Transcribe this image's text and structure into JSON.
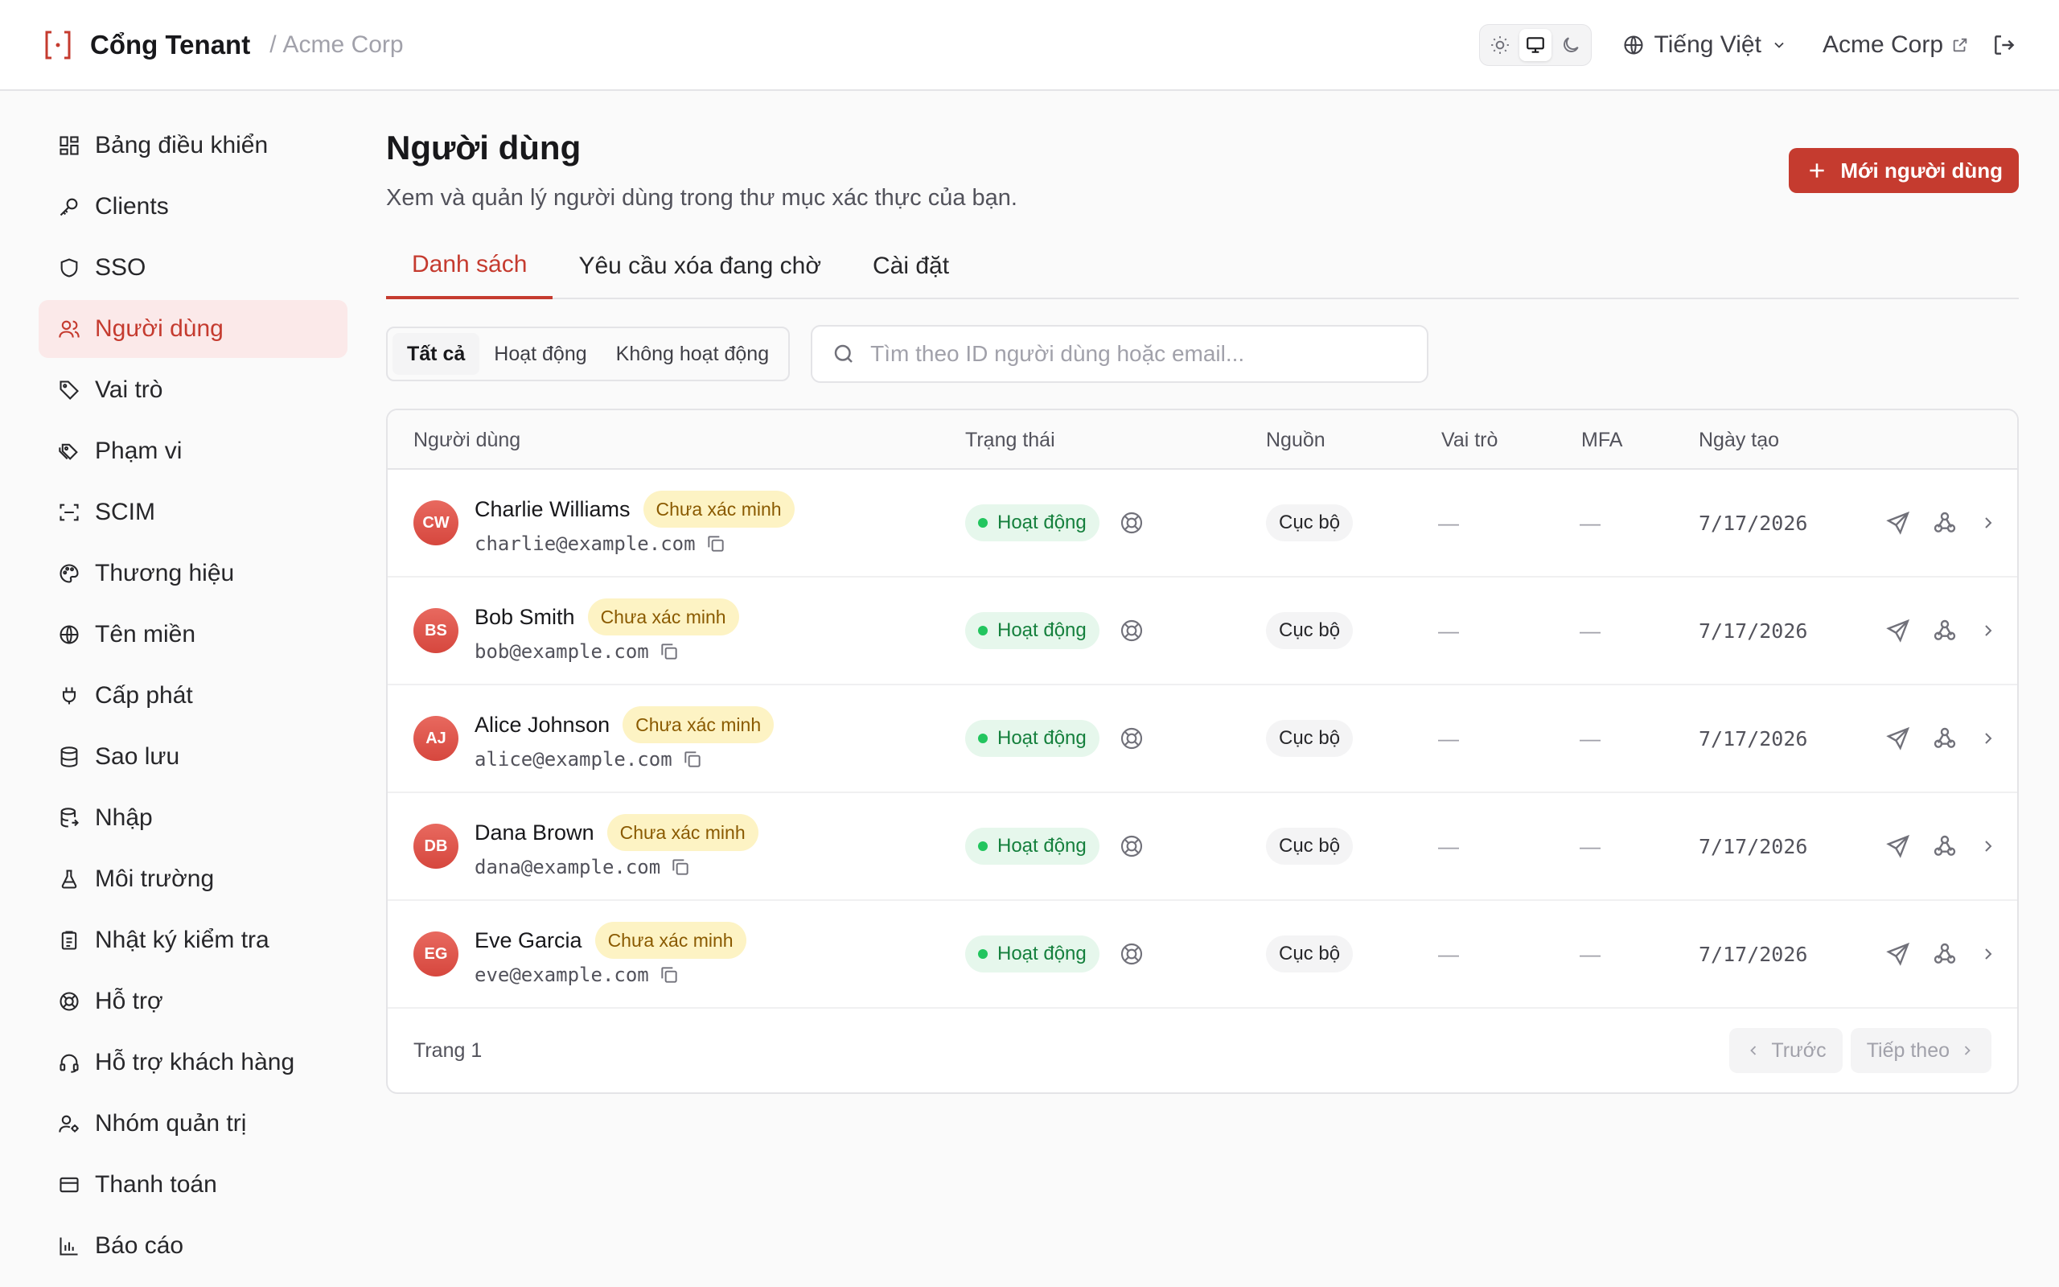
{
  "header": {
    "app_title": "Cổng Tenant",
    "crumb_sep": "/",
    "tenant": "Acme Corp",
    "language": "Tiếng Việt",
    "org_link": "Acme Corp",
    "theme_selected": "system"
  },
  "sidebar": {
    "items": [
      {
        "label": "Bảng điều khiển",
        "icon": "dashboard-icon"
      },
      {
        "label": "Clients",
        "icon": "key-icon"
      },
      {
        "label": "SSO",
        "icon": "shield-icon"
      },
      {
        "label": "Người dùng",
        "icon": "users-icon",
        "active": true
      },
      {
        "label": "Vai trò",
        "icon": "tag-icon"
      },
      {
        "label": "Phạm vi",
        "icon": "tags-icon"
      },
      {
        "label": "SCIM",
        "icon": "scan-icon"
      },
      {
        "label": "Thương hiệu",
        "icon": "palette-icon"
      },
      {
        "label": "Tên miền",
        "icon": "globe-icon"
      },
      {
        "label": "Cấp phát",
        "icon": "plug-icon"
      },
      {
        "label": "Sao lưu",
        "icon": "database-icon"
      },
      {
        "label": "Nhập",
        "icon": "database-import-icon"
      },
      {
        "label": "Môi trường",
        "icon": "flask-icon"
      },
      {
        "label": "Nhật ký kiểm tra",
        "icon": "clipboard-icon"
      },
      {
        "label": "Hỗ trợ",
        "icon": "lifebuoy-icon"
      },
      {
        "label": "Hỗ trợ khách hàng",
        "icon": "headset-icon"
      },
      {
        "label": "Nhóm quản trị",
        "icon": "user-cog-icon"
      },
      {
        "label": "Thanh toán",
        "icon": "credit-card-icon"
      },
      {
        "label": "Báo cáo",
        "icon": "bar-chart-icon"
      }
    ]
  },
  "main": {
    "title": "Người dùng",
    "subtitle": "Xem và quản lý người dùng trong thư mục xác thực của bạn.",
    "new_button": "Mới người dùng",
    "tabs": [
      {
        "label": "Danh sách",
        "active": true
      },
      {
        "label": "Yêu cầu xóa đang chờ"
      },
      {
        "label": "Cài đặt"
      }
    ],
    "filters": [
      {
        "label": "Tất cả",
        "active": true
      },
      {
        "label": "Hoạt động"
      },
      {
        "label": "Không hoạt động"
      }
    ],
    "search_placeholder": "Tìm theo ID người dùng hoặc email..."
  },
  "table": {
    "columns": [
      "Người dùng",
      "Trạng thái",
      "Nguồn",
      "Vai trò",
      "MFA",
      "Ngày tạo"
    ],
    "rows": [
      {
        "initials": "CW",
        "name": "Charlie Williams",
        "badge": "Chưa xác minh",
        "email": "charlie@example.com",
        "status": "Hoạt động",
        "source": "Cục bộ",
        "roles": "—",
        "mfa": "—",
        "created": "7/17/2026"
      },
      {
        "initials": "BS",
        "name": "Bob Smith",
        "badge": "Chưa xác minh",
        "email": "bob@example.com",
        "status": "Hoạt động",
        "source": "Cục bộ",
        "roles": "—",
        "mfa": "—",
        "created": "7/17/2026"
      },
      {
        "initials": "AJ",
        "name": "Alice Johnson",
        "badge": "Chưa xác minh",
        "email": "alice@example.com",
        "status": "Hoạt động",
        "source": "Cục bộ",
        "roles": "—",
        "mfa": "—",
        "created": "7/17/2026"
      },
      {
        "initials": "DB",
        "name": "Dana Brown",
        "badge": "Chưa xác minh",
        "email": "dana@example.com",
        "status": "Hoạt động",
        "source": "Cục bộ",
        "roles": "—",
        "mfa": "—",
        "created": "7/17/2026"
      },
      {
        "initials": "EG",
        "name": "Eve Garcia",
        "badge": "Chưa xác minh",
        "email": "eve@example.com",
        "status": "Hoạt động",
        "source": "Cục bộ",
        "roles": "—",
        "mfa": "—",
        "created": "7/17/2026"
      }
    ],
    "pager": {
      "page_label": "Trang 1",
      "prev": "Trước",
      "next": "Tiếp theo"
    }
  },
  "colors": {
    "accent": "#c53b2f",
    "active_bg": "#fbe9e9",
    "success": "#15803d",
    "warning_bg": "#fdf3c4"
  }
}
